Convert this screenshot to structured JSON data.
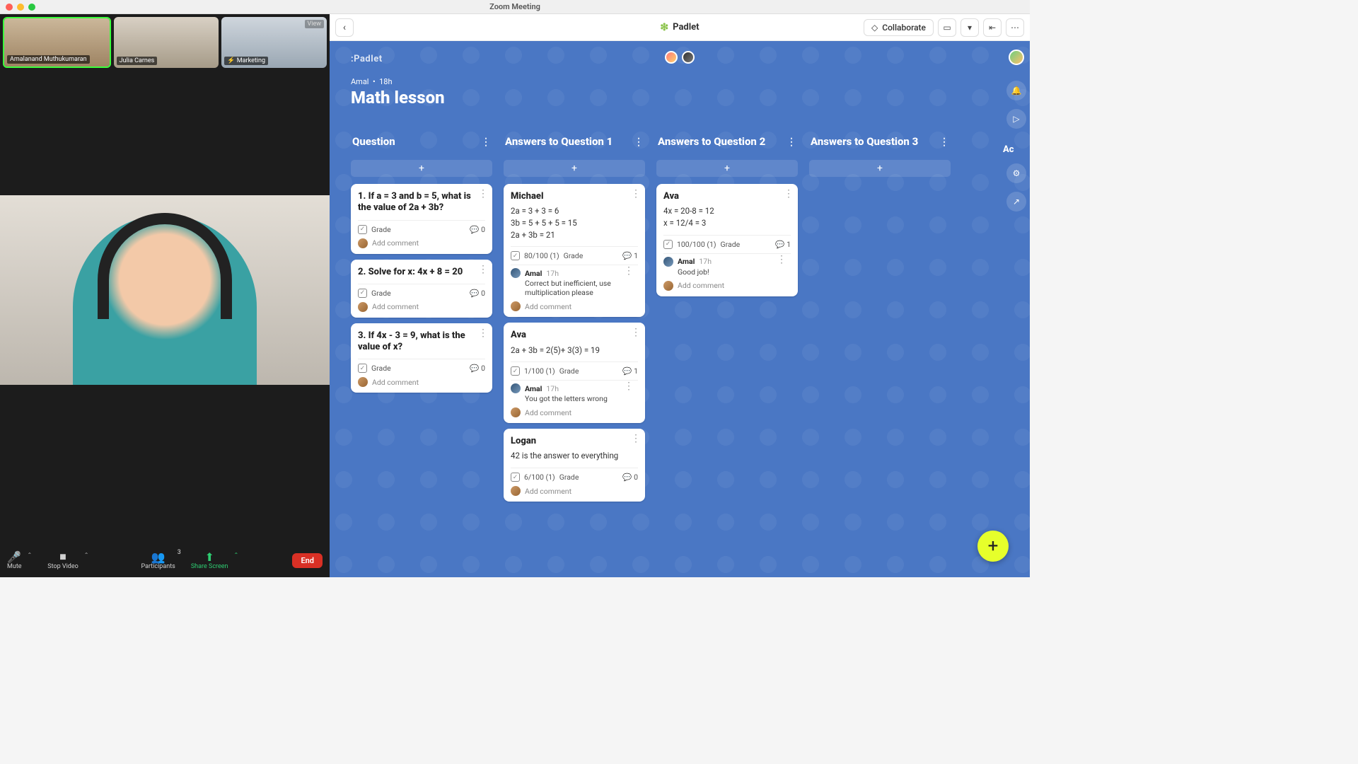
{
  "window": {
    "title": "Zoom Meeting"
  },
  "zoom": {
    "thumbs": [
      {
        "name": "Amalanand Muthukumaran",
        "speaking": true
      },
      {
        "name": "Julia Carnes",
        "speaking": false
      },
      {
        "name": "Marketing",
        "speaking": false,
        "muted": true,
        "view_label": "View"
      }
    ],
    "controls": {
      "mute": "Mute",
      "stop_video": "Stop Video",
      "participants": "Participants",
      "participant_count": "3",
      "share_screen": "Share Screen",
      "end": "End"
    }
  },
  "padlet": {
    "brand": "Padlet",
    "collaborate": "Collaborate",
    "header": {
      "author": "Amal",
      "age": "18h",
      "title": "Math lesson"
    },
    "partial_col_label": "Ac",
    "columns": [
      {
        "title": "Question",
        "cards": [
          {
            "title": "1. If a = 3 and b = 5, what is the value of 2a + 3b?",
            "grade_label": "Grade",
            "comments": "0",
            "add_comment": "Add comment"
          },
          {
            "title": "2. Solve for x: 4x + 8 = 20",
            "grade_label": "Grade",
            "comments": "0",
            "add_comment": "Add comment"
          },
          {
            "title": "3. If 4x - 3 = 9, what is the value of x?",
            "grade_label": "Grade",
            "comments": "0",
            "add_comment": "Add comment"
          }
        ]
      },
      {
        "title": "Answers to Question 1",
        "cards": [
          {
            "title": "Michael",
            "body": "2a = 3 + 3 = 6\n3b = 5 + 5 + 5 = 15\n2a + 3b = 21",
            "score": "80/100 (1)",
            "grade_label": "Grade",
            "comments": "1",
            "comment": {
              "name": "Amal",
              "time": "17h",
              "msg": "Correct but inefficient, use multiplication please"
            },
            "add_comment": "Add comment"
          },
          {
            "title": "Ava",
            "body": "2a + 3b = 2(5)+ 3(3) = 19",
            "score": "1/100 (1)",
            "grade_label": "Grade",
            "comments": "1",
            "comment": {
              "name": "Amal",
              "time": "17h",
              "msg": "You got the letters wrong"
            },
            "add_comment": "Add comment"
          },
          {
            "title": "Logan",
            "body": "42 is the answer to everything",
            "score": "6/100 (1)",
            "grade_label": "Grade",
            "comments": "0",
            "add_comment": "Add comment"
          }
        ]
      },
      {
        "title": "Answers to Question 2",
        "cards": [
          {
            "title": "Ava",
            "body": "4x = 20-8 = 12\nx = 12/4 = 3",
            "score": "100/100 (1)",
            "grade_label": "Grade",
            "comments": "1",
            "comment": {
              "name": "Amal",
              "time": "17h",
              "msg": "Good job!"
            },
            "add_comment": "Add comment"
          }
        ]
      },
      {
        "title": "Answers to Question 3",
        "cards": []
      }
    ]
  }
}
